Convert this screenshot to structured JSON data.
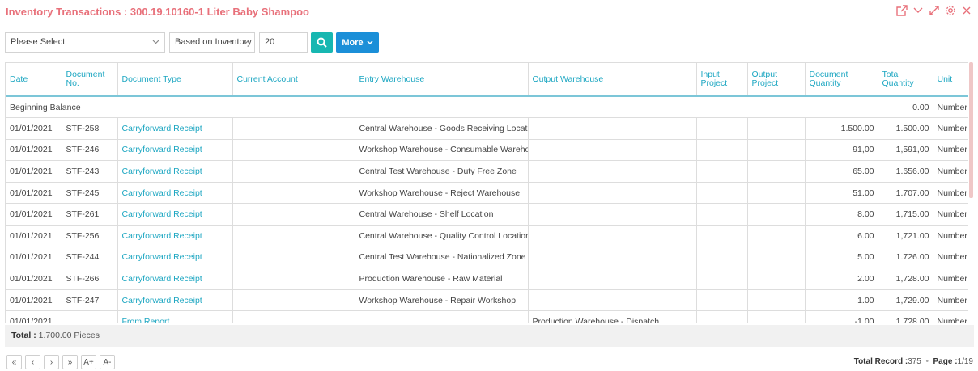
{
  "header": {
    "title": "Inventory Transactions : 300.19.10160-1 Liter Baby Shampoo"
  },
  "toolbar": {
    "select1": "Please Select",
    "select2": "Based on Inventory",
    "count_value": "20",
    "more_label": "More"
  },
  "table": {
    "columns": [
      "Date",
      "Document No.",
      "Document Type",
      "Current Account",
      "Entry Warehouse",
      "Output Warehouse",
      "Input Project",
      "Output Project",
      "Document Quantity",
      "Total Quantity",
      "Unit"
    ],
    "beginning": {
      "label": "Beginning Balance",
      "total": "0.00",
      "unit": "Number"
    },
    "rows": [
      [
        "01/01/2021",
        "STF-258",
        "Carryforward Receipt",
        "",
        "Central Warehouse - Goods Receiving Location",
        "",
        "",
        "",
        "1.500.00",
        "1.500.00",
        "Number"
      ],
      [
        "01/01/2021",
        "STF-246",
        "Carryforward Receipt",
        "",
        "Workshop Warehouse - Consumable Warehouse",
        "",
        "",
        "",
        "91,00",
        "1,591,00",
        "Number"
      ],
      [
        "01/01/2021",
        "STF-243",
        "Carryforward Receipt",
        "",
        "Central Test Warehouse - Duty Free Zone",
        "",
        "",
        "",
        "65.00",
        "1.656.00",
        "Number"
      ],
      [
        "01/01/2021",
        "STF-245",
        "Carryforward Receipt",
        "",
        "Workshop Warehouse - Reject Warehouse",
        "",
        "",
        "",
        "51.00",
        "1.707.00",
        "Number"
      ],
      [
        "01/01/2021",
        "STF-261",
        "Carryforward Receipt",
        "",
        "Central Warehouse - Shelf Location",
        "",
        "",
        "",
        "8.00",
        "1,715.00",
        "Number"
      ],
      [
        "01/01/2021",
        "STF-256",
        "Carryforward Receipt",
        "",
        "Central Warehouse - Quality Control Location",
        "",
        "",
        "",
        "6.00",
        "1,721.00",
        "Number"
      ],
      [
        "01/01/2021",
        "STF-244",
        "Carryforward Receipt",
        "",
        "Central Test Warehouse - Nationalized Zone",
        "",
        "",
        "",
        "5.00",
        "1.726.00",
        "Number"
      ],
      [
        "01/01/2021",
        "STF-266",
        "Carryforward Receipt",
        "",
        "Production Warehouse - Raw Material",
        "",
        "",
        "",
        "2.00",
        "1,728.00",
        "Number"
      ],
      [
        "01/01/2021",
        "STF-247",
        "Carryforward Receipt",
        "",
        "Workshop Warehouse - Repair Workshop",
        "",
        "",
        "",
        "1.00",
        "1,729.00",
        "Number"
      ],
      [
        "01/01/2021",
        "",
        "From Report",
        "",
        "",
        "Production Warehouse - Dispatch",
        "",
        "",
        "-1.00",
        "1,728.00",
        "Number"
      ]
    ]
  },
  "totals": {
    "label": "Total :",
    "value": "1.700.00 Pieces"
  },
  "pager": {
    "buttons": [
      "«",
      "‹",
      "›",
      "»",
      "A+",
      "A-"
    ]
  },
  "footer": {
    "total_record_label": "Total Record :",
    "total_record_value": "375",
    "separator": "•",
    "page_label": "Page :",
    "page_value": "1/19"
  },
  "colors": {
    "accent": "#e8707a",
    "teal": "#17b7b1",
    "blue": "#1b8fd8",
    "link": "#1ea7c2"
  }
}
